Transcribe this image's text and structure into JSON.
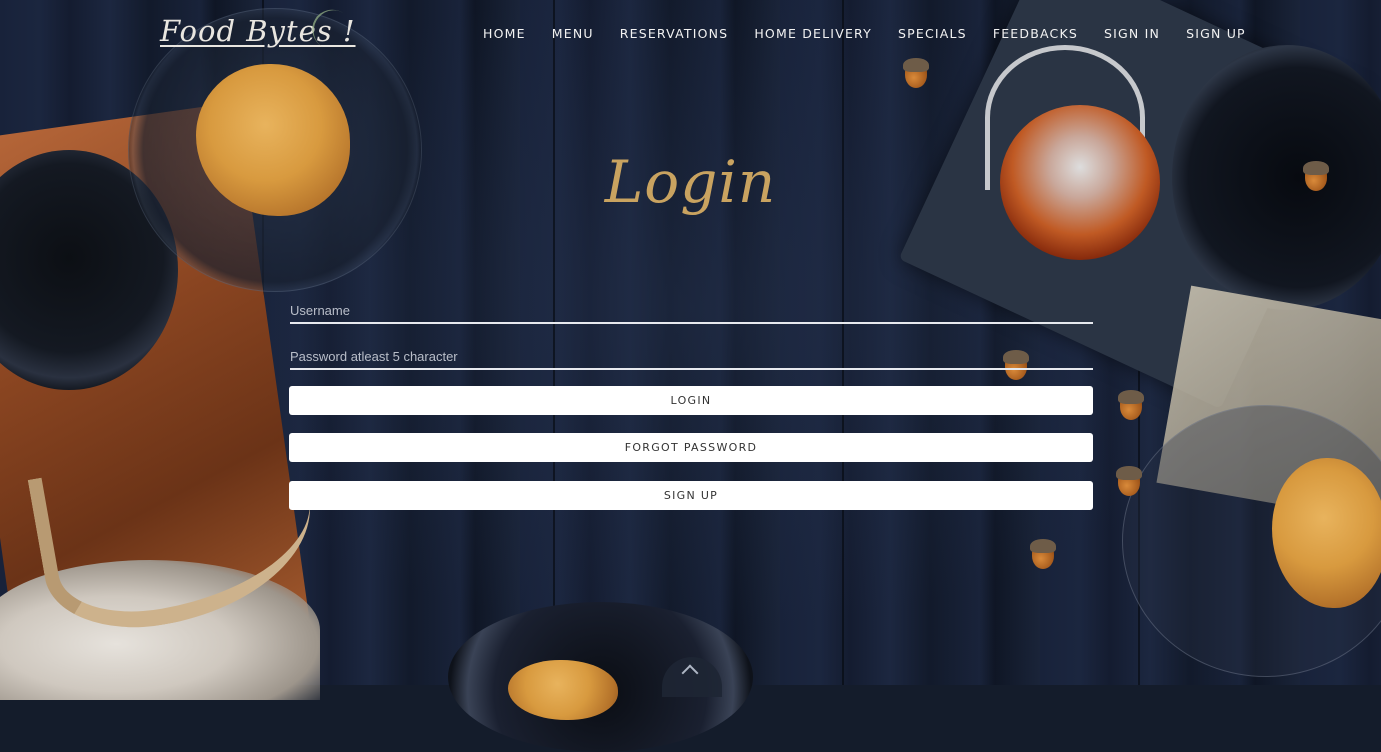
{
  "brand": {
    "logo_text": "Food Bytes !"
  },
  "nav": {
    "items": [
      {
        "label": "HOME"
      },
      {
        "label": "MENU"
      },
      {
        "label": "RESERVATIONS"
      },
      {
        "label": "HOME DELIVERY"
      },
      {
        "label": "SPECIALS"
      },
      {
        "label": "FEEDBACKS"
      },
      {
        "label": "SIGN IN"
      },
      {
        "label": "SIGN UP"
      }
    ]
  },
  "login": {
    "title": "Login",
    "username": {
      "placeholder": "Username",
      "value": ""
    },
    "password": {
      "placeholder": "Password atleast 5 character",
      "value": ""
    },
    "buttons": {
      "login": "LOGIN",
      "forgot": "FORGOT PASSWORD",
      "signup": "SIGN UP"
    }
  },
  "icons": {
    "scroll_top": "chevron-up-icon"
  },
  "colors": {
    "title_gold": "#c9a360",
    "background": "#141c2b",
    "button_bg": "#ffffff"
  }
}
